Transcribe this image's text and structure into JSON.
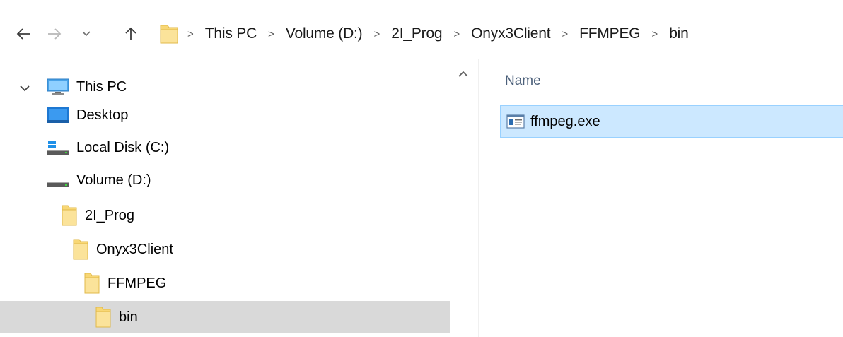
{
  "navigation": {
    "back_icon": "arrow-left-icon",
    "forward_icon": "arrow-right-icon",
    "recent_icon": "chevron-down-icon",
    "up_icon": "arrow-up-icon"
  },
  "address_bar": {
    "folder_icon": "folder-icon",
    "separator": ">",
    "breadcrumbs": [
      "This PC",
      "Volume (D:)",
      "2I_Prog",
      "Onyx3Client",
      "FFMPEG",
      "bin"
    ]
  },
  "nav_pane": {
    "items": [
      {
        "label": "This PC",
        "icon": "computer-icon",
        "expanded": true
      },
      {
        "label": "Desktop",
        "icon": "desktop-icon"
      },
      {
        "label": "Local Disk (C:)",
        "icon": "windows-drive-icon"
      },
      {
        "label": "Volume (D:)",
        "icon": "drive-icon"
      },
      {
        "label": "2I_Prog",
        "icon": "folder-icon"
      },
      {
        "label": "Onyx3Client",
        "icon": "folder-icon"
      },
      {
        "label": "FFMPEG",
        "icon": "folder-icon"
      },
      {
        "label": "bin",
        "icon": "folder-icon",
        "selected": true
      }
    ]
  },
  "file_list": {
    "column_header": "Name",
    "sort_icon": "chevron-up-icon",
    "files": [
      {
        "name": "ffmpeg.exe",
        "icon": "executable-icon",
        "selected": true
      }
    ]
  },
  "colors": {
    "selection_fill": "#cce8ff",
    "selection_border": "#99d1ff",
    "nav_selected": "#d9d9d9",
    "folder_yellow": "#f8d775",
    "header_text": "#4c607a"
  }
}
